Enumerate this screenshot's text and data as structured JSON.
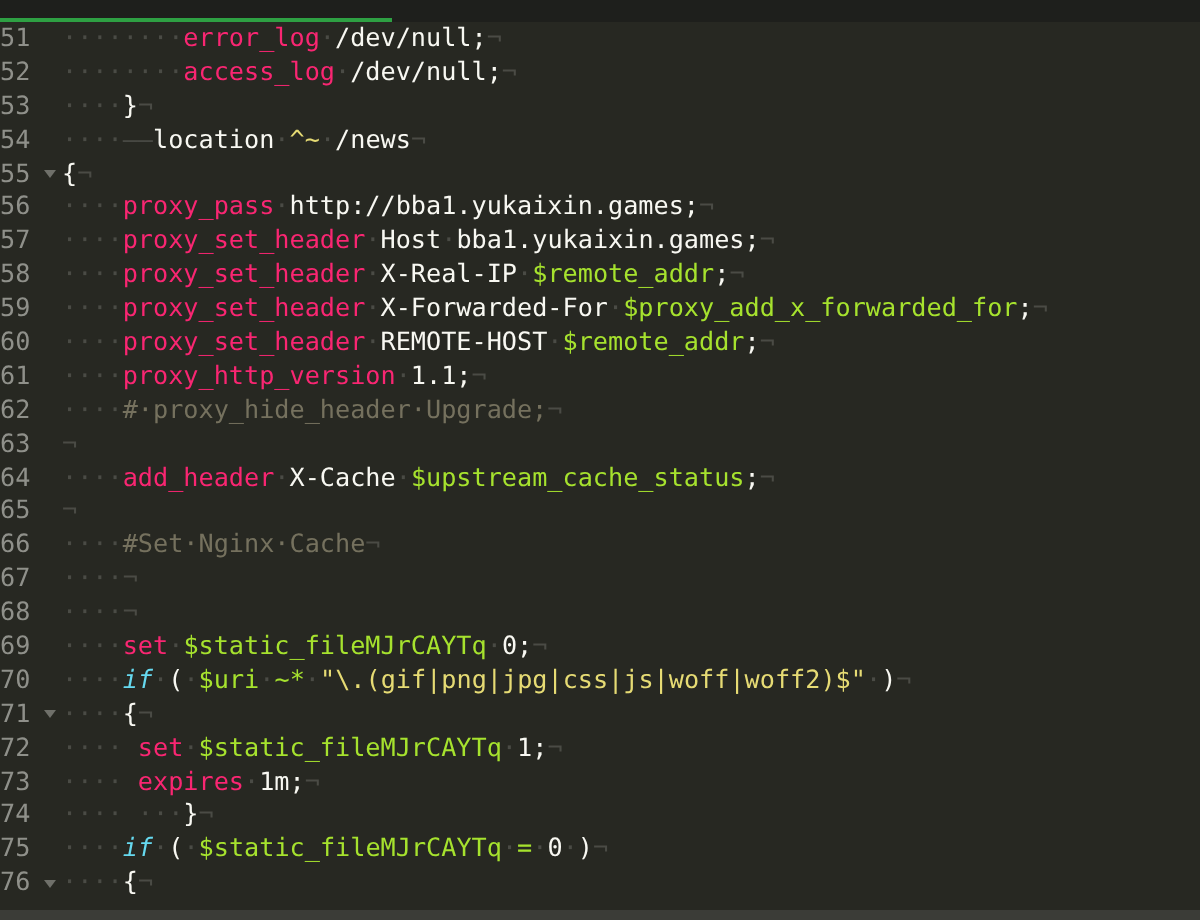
{
  "editor": {
    "lines": [
      {
        "number": "51",
        "fold": false,
        "tokens": [
          {
            "kind": "ws",
            "text": "········"
          },
          {
            "kind": "keyword",
            "text": "error_log"
          },
          {
            "kind": "ws",
            "text": "·"
          },
          {
            "kind": "plain",
            "text": "/dev/null;"
          },
          {
            "kind": "ws",
            "text": "¬"
          }
        ]
      },
      {
        "number": "52",
        "fold": false,
        "tokens": [
          {
            "kind": "ws",
            "text": "········"
          },
          {
            "kind": "keyword",
            "text": "access_log"
          },
          {
            "kind": "ws",
            "text": "·"
          },
          {
            "kind": "plain",
            "text": "/dev/null;"
          },
          {
            "kind": "ws",
            "text": "¬"
          }
        ]
      },
      {
        "number": "53",
        "fold": false,
        "tokens": [
          {
            "kind": "ws",
            "text": "····"
          },
          {
            "kind": "plain",
            "text": "}"
          },
          {
            "kind": "ws",
            "text": "¬"
          }
        ]
      },
      {
        "number": "54",
        "fold": false,
        "tokens": [
          {
            "kind": "ws",
            "text": "····——"
          },
          {
            "kind": "plain",
            "text": "location"
          },
          {
            "kind": "ws",
            "text": "·"
          },
          {
            "kind": "string",
            "text": "^~"
          },
          {
            "kind": "ws",
            "text": "·"
          },
          {
            "kind": "plain",
            "text": "/news"
          },
          {
            "kind": "ws",
            "text": "¬"
          }
        ]
      },
      {
        "number": "55",
        "fold": true,
        "tokens": [
          {
            "kind": "plain",
            "text": "{"
          },
          {
            "kind": "ws",
            "text": "¬"
          }
        ]
      },
      {
        "number": "56",
        "fold": false,
        "tokens": [
          {
            "kind": "ws",
            "text": "····"
          },
          {
            "kind": "keyword",
            "text": "proxy_pass"
          },
          {
            "kind": "ws",
            "text": "·"
          },
          {
            "kind": "plain",
            "text": "http://bba1.yukaixin.games;"
          },
          {
            "kind": "ws",
            "text": "¬"
          }
        ]
      },
      {
        "number": "57",
        "fold": false,
        "tokens": [
          {
            "kind": "ws",
            "text": "····"
          },
          {
            "kind": "keyword",
            "text": "proxy_set_header"
          },
          {
            "kind": "ws",
            "text": "·"
          },
          {
            "kind": "plain",
            "text": "Host"
          },
          {
            "kind": "ws",
            "text": "·"
          },
          {
            "kind": "plain",
            "text": "bba1.yukaixin.games;"
          },
          {
            "kind": "ws",
            "text": "¬"
          }
        ]
      },
      {
        "number": "58",
        "fold": false,
        "tokens": [
          {
            "kind": "ws",
            "text": "····"
          },
          {
            "kind": "keyword",
            "text": "proxy_set_header"
          },
          {
            "kind": "ws",
            "text": "·"
          },
          {
            "kind": "plain",
            "text": "X-Real-IP"
          },
          {
            "kind": "ws",
            "text": "·"
          },
          {
            "kind": "variable",
            "text": "$remote_addr"
          },
          {
            "kind": "plain",
            "text": ";"
          },
          {
            "kind": "ws",
            "text": "¬"
          }
        ]
      },
      {
        "number": "59",
        "fold": false,
        "tokens": [
          {
            "kind": "ws",
            "text": "····"
          },
          {
            "kind": "keyword",
            "text": "proxy_set_header"
          },
          {
            "kind": "ws",
            "text": "·"
          },
          {
            "kind": "plain",
            "text": "X-Forwarded-For"
          },
          {
            "kind": "ws",
            "text": "·"
          },
          {
            "kind": "variable",
            "text": "$proxy_add_x_forwarded_for"
          },
          {
            "kind": "plain",
            "text": ";"
          },
          {
            "kind": "ws",
            "text": "¬"
          }
        ]
      },
      {
        "number": "60",
        "fold": false,
        "tokens": [
          {
            "kind": "ws",
            "text": "····"
          },
          {
            "kind": "keyword",
            "text": "proxy_set_header"
          },
          {
            "kind": "ws",
            "text": "·"
          },
          {
            "kind": "plain",
            "text": "REMOTE-HOST"
          },
          {
            "kind": "ws",
            "text": "·"
          },
          {
            "kind": "variable",
            "text": "$remote_addr"
          },
          {
            "kind": "plain",
            "text": ";"
          },
          {
            "kind": "ws",
            "text": "¬"
          }
        ]
      },
      {
        "number": "61",
        "fold": false,
        "tokens": [
          {
            "kind": "ws",
            "text": "····"
          },
          {
            "kind": "keyword",
            "text": "proxy_http_version"
          },
          {
            "kind": "ws",
            "text": "·"
          },
          {
            "kind": "plain",
            "text": "1.1;"
          },
          {
            "kind": "ws",
            "text": "¬"
          }
        ]
      },
      {
        "number": "62",
        "fold": false,
        "tokens": [
          {
            "kind": "ws",
            "text": "····"
          },
          {
            "kind": "comment",
            "text": "#·proxy_hide_header·Upgrade;"
          },
          {
            "kind": "ws",
            "text": "¬"
          }
        ]
      },
      {
        "number": "63",
        "fold": false,
        "tokens": [
          {
            "kind": "ws",
            "text": "¬"
          }
        ]
      },
      {
        "number": "64",
        "fold": false,
        "tokens": [
          {
            "kind": "ws",
            "text": "····"
          },
          {
            "kind": "keyword",
            "text": "add_header"
          },
          {
            "kind": "ws",
            "text": "·"
          },
          {
            "kind": "plain",
            "text": "X-Cache"
          },
          {
            "kind": "ws",
            "text": "·"
          },
          {
            "kind": "variable",
            "text": "$upstream_cache_status"
          },
          {
            "kind": "plain",
            "text": ";"
          },
          {
            "kind": "ws",
            "text": "¬"
          }
        ]
      },
      {
        "number": "65",
        "fold": false,
        "tokens": [
          {
            "kind": "ws",
            "text": "¬"
          }
        ]
      },
      {
        "number": "66",
        "fold": false,
        "tokens": [
          {
            "kind": "ws",
            "text": "····"
          },
          {
            "kind": "comment",
            "text": "#Set·Nginx·Cache"
          },
          {
            "kind": "ws",
            "text": "¬"
          }
        ]
      },
      {
        "number": "67",
        "fold": false,
        "tokens": [
          {
            "kind": "ws",
            "text": "····¬"
          }
        ]
      },
      {
        "number": "68",
        "fold": false,
        "tokens": [
          {
            "kind": "ws",
            "text": "····¬"
          }
        ]
      },
      {
        "number": "69",
        "fold": false,
        "tokens": [
          {
            "kind": "ws",
            "text": "····"
          },
          {
            "kind": "keyword",
            "text": "set"
          },
          {
            "kind": "ws",
            "text": "·"
          },
          {
            "kind": "variable",
            "text": "$static_fileMJrCAYTq"
          },
          {
            "kind": "ws",
            "text": "·"
          },
          {
            "kind": "plain",
            "text": "0;"
          },
          {
            "kind": "ws",
            "text": "¬"
          }
        ]
      },
      {
        "number": "70",
        "fold": false,
        "tokens": [
          {
            "kind": "ws",
            "text": "····"
          },
          {
            "kind": "control",
            "text": "if"
          },
          {
            "kind": "ws",
            "text": "·"
          },
          {
            "kind": "plain",
            "text": "("
          },
          {
            "kind": "ws",
            "text": "·"
          },
          {
            "kind": "variable",
            "text": "$uri"
          },
          {
            "kind": "ws",
            "text": "·"
          },
          {
            "kind": "variable",
            "text": "~*"
          },
          {
            "kind": "ws",
            "text": "·"
          },
          {
            "kind": "string",
            "text": "\"\\.(gif|png|jpg|css|js|woff|woff2)$\""
          },
          {
            "kind": "ws",
            "text": "·"
          },
          {
            "kind": "plain",
            "text": ")"
          },
          {
            "kind": "ws",
            "text": "¬"
          }
        ]
      },
      {
        "number": "71",
        "fold": true,
        "tokens": [
          {
            "kind": "ws",
            "text": "····"
          },
          {
            "kind": "plain",
            "text": "{"
          },
          {
            "kind": "ws",
            "text": "¬"
          }
        ]
      },
      {
        "number": "72",
        "fold": false,
        "tokens": [
          {
            "kind": "ws",
            "text": "···· "
          },
          {
            "kind": "keyword",
            "text": "set"
          },
          {
            "kind": "ws",
            "text": "·"
          },
          {
            "kind": "variable",
            "text": "$static_fileMJrCAYTq"
          },
          {
            "kind": "ws",
            "text": "·"
          },
          {
            "kind": "plain",
            "text": "1;"
          },
          {
            "kind": "ws",
            "text": "¬"
          }
        ]
      },
      {
        "number": "73",
        "fold": false,
        "tokens": [
          {
            "kind": "ws",
            "text": "···· "
          },
          {
            "kind": "keyword",
            "text": "expires"
          },
          {
            "kind": "ws",
            "text": "·"
          },
          {
            "kind": "plain",
            "text": "1m;"
          },
          {
            "kind": "ws",
            "text": "¬"
          }
        ]
      },
      {
        "number": "74",
        "fold": false,
        "tokens": [
          {
            "kind": "ws",
            "text": "···· ···"
          },
          {
            "kind": "plain",
            "text": "}"
          },
          {
            "kind": "ws",
            "text": "¬"
          }
        ]
      },
      {
        "number": "75",
        "fold": false,
        "tokens": [
          {
            "kind": "ws",
            "text": "····"
          },
          {
            "kind": "control",
            "text": "if"
          },
          {
            "kind": "ws",
            "text": "·"
          },
          {
            "kind": "plain",
            "text": "("
          },
          {
            "kind": "ws",
            "text": "·"
          },
          {
            "kind": "variable",
            "text": "$static_fileMJrCAYTq"
          },
          {
            "kind": "ws",
            "text": "·"
          },
          {
            "kind": "variable",
            "text": "="
          },
          {
            "kind": "ws",
            "text": "·"
          },
          {
            "kind": "plain",
            "text": "0"
          },
          {
            "kind": "ws",
            "text": "·"
          },
          {
            "kind": "plain",
            "text": ")"
          },
          {
            "kind": "ws",
            "text": "¬"
          }
        ]
      },
      {
        "number": "76",
        "fold": true,
        "tokens": [
          {
            "kind": "ws",
            "text": "····"
          },
          {
            "kind": "plain",
            "text": "{"
          },
          {
            "kind": "ws",
            "text": "¬"
          }
        ]
      }
    ]
  }
}
